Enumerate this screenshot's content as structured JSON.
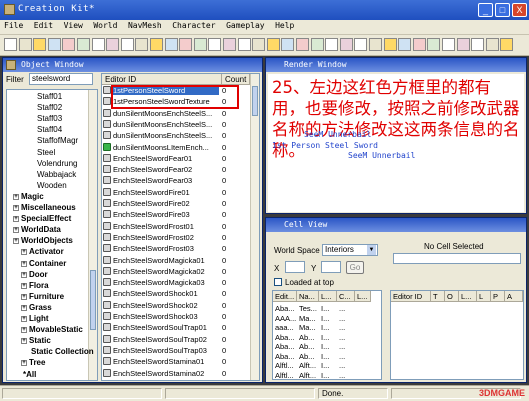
{
  "window": {
    "title": "Creation Kit*",
    "min": "_",
    "max": "□",
    "close": "X"
  },
  "menu": [
    "File",
    "Edit",
    "View",
    "World",
    "NavMesh",
    "Character",
    "Gameplay",
    "Help"
  ],
  "object_window": {
    "title": "Object Window",
    "filter_label": "Filter",
    "filter_value": "steelsword",
    "tree": [
      {
        "label": "Staff01"
      },
      {
        "label": "Staff02"
      },
      {
        "label": "Staff03"
      },
      {
        "label": "Staff04"
      },
      {
        "label": "StaffofMagr"
      },
      {
        "label": "Steel"
      },
      {
        "label": "Volendrung"
      },
      {
        "label": "Wabbajack"
      },
      {
        "label": "Wooden"
      },
      {
        "label": "Magic",
        "bold": true,
        "plus": true
      },
      {
        "label": "Miscellaneous",
        "bold": true,
        "plus": true
      },
      {
        "label": "SpecialEffect",
        "bold": true,
        "plus": true
      },
      {
        "label": "WorldData",
        "bold": true,
        "plus": true
      },
      {
        "label": "WorldObjects",
        "bold": true,
        "plus": true
      },
      {
        "label": "Activator",
        "bold": true,
        "plus": true,
        "indent": 1
      },
      {
        "label": "Container",
        "bold": true,
        "plus": true,
        "indent": 1
      },
      {
        "label": "Door",
        "bold": true,
        "plus": true,
        "indent": 1
      },
      {
        "label": "Flora",
        "bold": true,
        "plus": true,
        "indent": 1
      },
      {
        "label": "Furniture",
        "bold": true,
        "plus": true,
        "indent": 1
      },
      {
        "label": "Grass",
        "bold": true,
        "plus": true,
        "indent": 1
      },
      {
        "label": "Light",
        "bold": true,
        "plus": true,
        "indent": 1
      },
      {
        "label": "MovableStatic",
        "bold": true,
        "plus": true,
        "indent": 1
      },
      {
        "label": "Static",
        "bold": true,
        "plus": true,
        "indent": 1
      },
      {
        "label": "Static Collection",
        "bold": true,
        "plus": false,
        "indent": 1
      },
      {
        "label": "Tree",
        "bold": true,
        "plus": true,
        "indent": 1
      },
      {
        "label": "*All",
        "bold": true,
        "plus": false
      }
    ],
    "columns": [
      "Editor ID",
      "Count"
    ],
    "rows": [
      {
        "id": "1stPersonSteelSword",
        "count": "0",
        "icon": "sword",
        "sel": true
      },
      {
        "id": "1stPersonSteelSwordTexture",
        "count": "0",
        "icon": "sword"
      },
      {
        "id": "dunSilentMoonsEnchSteelS...",
        "count": "0",
        "icon": "sword"
      },
      {
        "id": "dunSilentMoonsEnchSteelS...",
        "count": "0",
        "icon": "sword"
      },
      {
        "id": "dunSilentMoonsEnchSteelS...",
        "count": "0",
        "icon": "sword"
      },
      {
        "id": "dunSilentMoonsLItemEnch...",
        "count": "0",
        "icon": "green"
      },
      {
        "id": "EnchSteelSwordFear01",
        "count": "0",
        "icon": "sword"
      },
      {
        "id": "EnchSteelSwordFear02",
        "count": "0",
        "icon": "sword"
      },
      {
        "id": "EnchSteelSwordFear03",
        "count": "0",
        "icon": "sword"
      },
      {
        "id": "EnchSteelSwordFire01",
        "count": "0",
        "icon": "sword"
      },
      {
        "id": "EnchSteelSwordFire02",
        "count": "0",
        "icon": "sword"
      },
      {
        "id": "EnchSteelSwordFire03",
        "count": "0",
        "icon": "sword"
      },
      {
        "id": "EnchSteelSwordFrost01",
        "count": "0",
        "icon": "sword"
      },
      {
        "id": "EnchSteelSwordFrost02",
        "count": "0",
        "icon": "sword"
      },
      {
        "id": "EnchSteelSwordFrost03",
        "count": "0",
        "icon": "sword"
      },
      {
        "id": "EnchSteelSwordMagicka01",
        "count": "0",
        "icon": "sword"
      },
      {
        "id": "EnchSteelSwordMagicka02",
        "count": "0",
        "icon": "sword"
      },
      {
        "id": "EnchSteelSwordMagicka03",
        "count": "0",
        "icon": "sword"
      },
      {
        "id": "EnchSteelSwordShock01",
        "count": "0",
        "icon": "sword"
      },
      {
        "id": "EnchSteelSwordShock02",
        "count": "0",
        "icon": "sword"
      },
      {
        "id": "EnchSteelSwordShock03",
        "count": "0",
        "icon": "sword"
      },
      {
        "id": "EnchSteelSwordSoulTrap01",
        "count": "0",
        "icon": "sword"
      },
      {
        "id": "EnchSteelSwordSoulTrap02",
        "count": "0",
        "icon": "sword"
      },
      {
        "id": "EnchSteelSwordSoulTrap03",
        "count": "0",
        "icon": "sword"
      },
      {
        "id": "EnchSteelSwordStamina01",
        "count": "0",
        "icon": "sword"
      },
      {
        "id": "EnchSteelSwordStamina02",
        "count": "0",
        "icon": "sword"
      }
    ]
  },
  "render_window": {
    "title": "Render Window",
    "note": "25、左边这红色方框里的都有用，也要修改，按照之前修改武器名称的方法修改这这两条信息的名称。",
    "overlay": [
      "1st Person Steel Sword",
      "SeeM Unnerbail",
      "SeeM Unnerbail"
    ]
  },
  "cell_view": {
    "title": "Cell View",
    "world_space_label": "World Space",
    "world_space_value": "Interiors",
    "x_label": "X",
    "y_label": "Y",
    "go": "Go",
    "loaded_at_top": "Loaded at top",
    "no_cell": "No Cell Selected",
    "left_columns": [
      "Edit...",
      "Na...",
      "L...",
      "C...",
      "L..."
    ],
    "left_rows": [
      [
        "Aba...",
        "Tes...",
        "I...",
        "...",
        ""
      ],
      [
        "AAA...",
        "Ma...",
        "I...",
        "...",
        ""
      ],
      [
        "aaa...",
        "Ma...",
        "I...",
        "...",
        ""
      ],
      [
        "Aba...",
        "Ab...",
        "I...",
        "...",
        ""
      ],
      [
        "Aba...",
        "Ab...",
        "I...",
        "...",
        ""
      ],
      [
        "Aba...",
        "Ab...",
        "I...",
        "...",
        ""
      ],
      [
        "Alftl...",
        "Alft...",
        "I...",
        "...",
        ""
      ],
      [
        "Alftl...",
        "Alft...",
        "I...",
        "...",
        ""
      ]
    ],
    "right_columns": [
      "Editor ID",
      "T",
      "O",
      "L...",
      "L",
      "P",
      "A"
    ]
  },
  "status": {
    "done": "Done."
  },
  "watermark": "3DMGAME"
}
